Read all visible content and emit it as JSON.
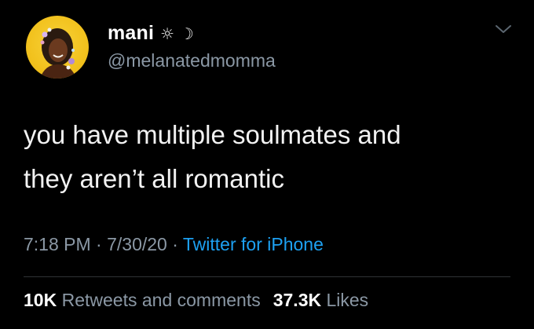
{
  "tweet": {
    "display_name": "mani",
    "name_emoji": "☼ ☽",
    "handle": "@melanatedmomma",
    "text": "you have multiple soulmates and\nthey aren’t all romantic",
    "time": "7:18 PM",
    "date": "7/30/20",
    "source": "Twitter for iPhone",
    "separator": " · "
  },
  "stats": {
    "retweets_count": "10K",
    "retweets_label": "Retweets and comments",
    "likes_count": "37.3K",
    "likes_label": "Likes"
  },
  "icons": {
    "menu": "chevron-down-icon"
  },
  "colors": {
    "background": "#000000",
    "text": "#ffffff",
    "secondary": "#8b98a5",
    "link": "#1da1f2",
    "avatar_bg": "#f2c21e"
  }
}
